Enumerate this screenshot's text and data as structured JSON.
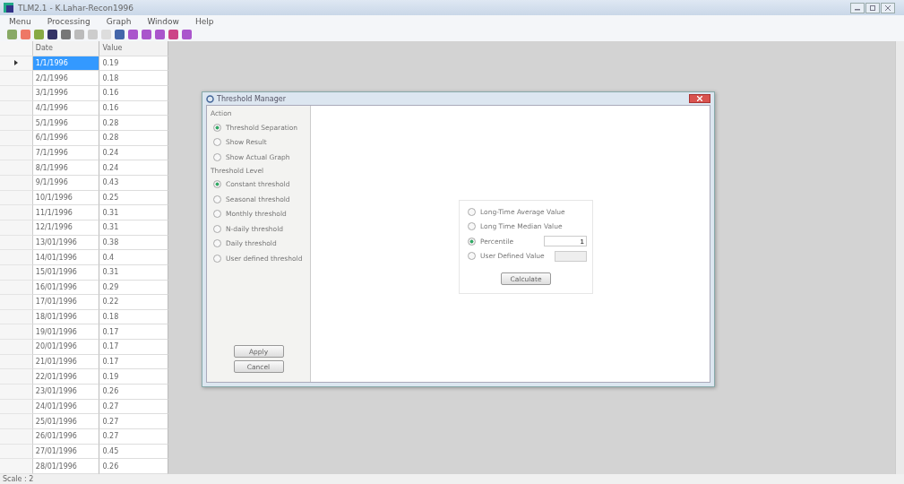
{
  "window": {
    "title": "TLM2.1 - K.Lahar-Recon1996"
  },
  "menu": [
    "Menu",
    "Processing",
    "Graph",
    "Window",
    "Help"
  ],
  "table": {
    "columns": [
      "Date",
      "Value"
    ],
    "rows": [
      {
        "date": "1/1/1996",
        "value": "0.19",
        "selected": true
      },
      {
        "date": "2/1/1996",
        "value": "0.18",
        "selected": false
      },
      {
        "date": "3/1/1996",
        "value": "0.16",
        "selected": false
      },
      {
        "date": "4/1/1996",
        "value": "0.16",
        "selected": false
      },
      {
        "date": "5/1/1996",
        "value": "0.28",
        "selected": false
      },
      {
        "date": "6/1/1996",
        "value": "0.28",
        "selected": false
      },
      {
        "date": "7/1/1996",
        "value": "0.24",
        "selected": false
      },
      {
        "date": "8/1/1996",
        "value": "0.24",
        "selected": false
      },
      {
        "date": "9/1/1996",
        "value": "0.43",
        "selected": false
      },
      {
        "date": "10/1/1996",
        "value": "0.25",
        "selected": false
      },
      {
        "date": "11/1/1996",
        "value": "0.31",
        "selected": false
      },
      {
        "date": "12/1/1996",
        "value": "0.31",
        "selected": false
      },
      {
        "date": "13/01/1996",
        "value": "0.38",
        "selected": false
      },
      {
        "date": "14/01/1996",
        "value": "0.4",
        "selected": false
      },
      {
        "date": "15/01/1996",
        "value": "0.31",
        "selected": false
      },
      {
        "date": "16/01/1996",
        "value": "0.29",
        "selected": false
      },
      {
        "date": "17/01/1996",
        "value": "0.22",
        "selected": false
      },
      {
        "date": "18/01/1996",
        "value": "0.18",
        "selected": false
      },
      {
        "date": "19/01/1996",
        "value": "0.17",
        "selected": false
      },
      {
        "date": "20/01/1996",
        "value": "0.17",
        "selected": false
      },
      {
        "date": "21/01/1996",
        "value": "0.17",
        "selected": false
      },
      {
        "date": "22/01/1996",
        "value": "0.19",
        "selected": false
      },
      {
        "date": "23/01/1996",
        "value": "0.26",
        "selected": false
      },
      {
        "date": "24/01/1996",
        "value": "0.27",
        "selected": false
      },
      {
        "date": "25/01/1996",
        "value": "0.27",
        "selected": false
      },
      {
        "date": "26/01/1996",
        "value": "0.27",
        "selected": false
      },
      {
        "date": "27/01/1996",
        "value": "0.45",
        "selected": false
      },
      {
        "date": "28/01/1996",
        "value": "0.26",
        "selected": false
      }
    ]
  },
  "dialog": {
    "title": "Threshold Manager",
    "action": {
      "label": "Action",
      "options": [
        {
          "label": "Threshold Separation",
          "selected": true
        },
        {
          "label": "Show Result",
          "selected": false
        },
        {
          "label": "Show Actual Graph",
          "selected": false
        }
      ]
    },
    "threshold_level": {
      "label": "Threshold Level",
      "options": [
        {
          "label": "Constant threshold",
          "selected": true
        },
        {
          "label": "Seasonal threshold",
          "selected": false
        },
        {
          "label": "Monthly threshold",
          "selected": false
        },
        {
          "label": "N-daily threshold",
          "selected": false
        },
        {
          "label": "Daily threshold",
          "selected": false
        },
        {
          "label": "User defined threshold",
          "selected": false
        }
      ]
    },
    "buttons": [
      "Apply",
      "Cancel"
    ],
    "value_options": [
      {
        "label": "Long-Time Average Value",
        "selected": false
      },
      {
        "label": "Long Time Median Value",
        "selected": false
      },
      {
        "label": "Percentile",
        "selected": true,
        "field": {
          "value": "1"
        }
      },
      {
        "label": "User Defined Value",
        "selected": false,
        "field": {
          "disabled": true
        }
      }
    ],
    "calculate_button": "Calculate"
  },
  "status_bar": {
    "text": "Scale : 2"
  }
}
